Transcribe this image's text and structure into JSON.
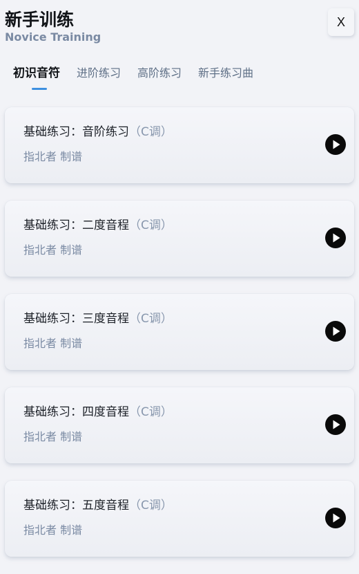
{
  "header": {
    "title_cn": "新手训练",
    "title_en": "Novice Training",
    "close_label": "X"
  },
  "tabs": [
    {
      "label": "初识音符",
      "active": true
    },
    {
      "label": "进阶练习",
      "active": false
    },
    {
      "label": "高阶练习",
      "active": false
    },
    {
      "label": "新手练习曲",
      "active": false
    }
  ],
  "lessons": [
    {
      "title": "基础练习：音阶练习",
      "key": "（C调）",
      "author": "指北者 制谱"
    },
    {
      "title": "基础练习：二度音程",
      "key": "（C调）",
      "author": "指北者 制谱"
    },
    {
      "title": "基础练习：三度音程",
      "key": "（C调）",
      "author": "指北者 制谱"
    },
    {
      "title": "基础练习：四度音程",
      "key": "（C调）",
      "author": "指北者 制谱"
    },
    {
      "title": "基础练习：五度音程",
      "key": "（C调）",
      "author": "指北者 制谱"
    }
  ],
  "icons": {
    "play": "play-icon",
    "close": "close-icon"
  },
  "colors": {
    "accent": "#3d8fe0",
    "secondary_text": "#7a8aa3"
  }
}
